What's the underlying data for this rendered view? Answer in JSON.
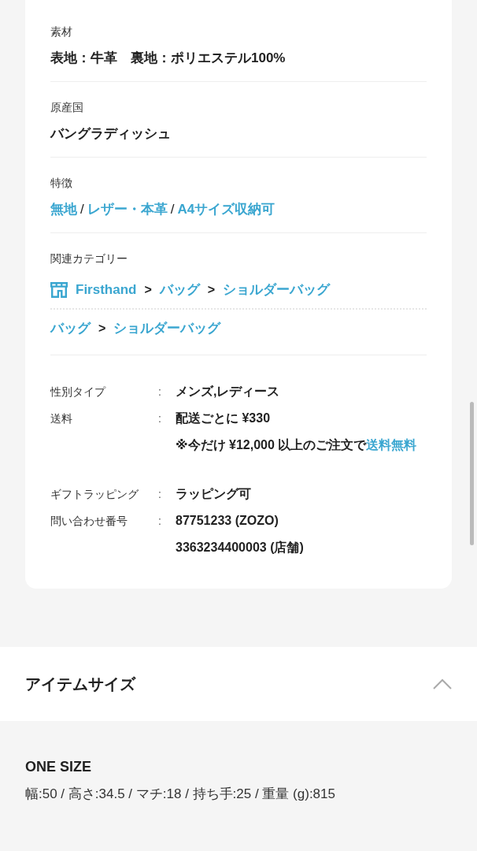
{
  "details": {
    "sections": [
      {
        "label": "素材",
        "kind": "text",
        "value": "表地：牛革　裏地：ポリエステル100%"
      },
      {
        "label": "原産国",
        "kind": "text",
        "value": "バングラディッシュ"
      },
      {
        "label": "特徴",
        "kind": "tags",
        "separator": "/",
        "tags": [
          "無地",
          "レザー・本革",
          "A4サイズ収納可"
        ]
      },
      {
        "label": "関連カテゴリー",
        "kind": "categories",
        "separator": ">",
        "paths": [
          {
            "shop": true,
            "items": [
              "Firsthand",
              "バッグ",
              "ショルダーバッグ"
            ]
          },
          {
            "shop": false,
            "items": [
              "バッグ",
              "ショルダーバッグ"
            ]
          }
        ]
      }
    ],
    "spec_separator": ":",
    "specs": [
      {
        "label": "性別タイプ",
        "values": [
          {
            "text": "メンズ,レディース"
          }
        ]
      },
      {
        "label": "送料",
        "values": [
          {
            "text": "配送ごとに ¥330"
          },
          {
            "text": "※今だけ ¥12,000 以上のご注文で",
            "link": "送料無料"
          }
        ]
      },
      {
        "label": "ギフトラッピング",
        "values": [
          {
            "text": "ラッピング可"
          }
        ]
      },
      {
        "label": "問い合わせ番号",
        "values": [
          {
            "text": "87751233 (ZOZO)"
          },
          {
            "text": "3363234400003 (店舗)"
          }
        ]
      }
    ]
  },
  "item_size": {
    "title": "アイテムサイズ",
    "expanded": true,
    "size": "ONE SIZE",
    "measurements": "幅:50 / 高さ:34.5 / マチ:18 / 持ち手:25 / 重量 (g):815"
  }
}
